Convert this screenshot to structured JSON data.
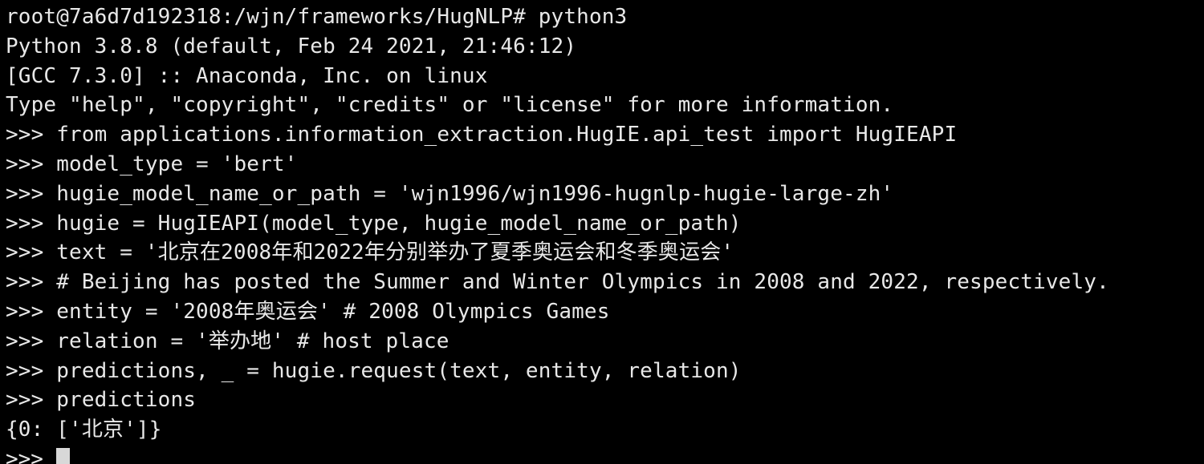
{
  "terminal": {
    "lines": [
      "root@7a6d7d192318:/wjn/frameworks/HugNLP# python3",
      "Python 3.8.8 (default, Feb 24 2021, 21:46:12)",
      "[GCC 7.3.0] :: Anaconda, Inc. on linux",
      "Type \"help\", \"copyright\", \"credits\" or \"license\" for more information.",
      ">>> from applications.information_extraction.HugIE.api_test import HugIEAPI",
      ">>> model_type = 'bert'",
      ">>> hugie_model_name_or_path = 'wjn1996/wjn1996-hugnlp-hugie-large-zh'",
      ">>> hugie = HugIEAPI(model_type, hugie_model_name_or_path)",
      ">>> text = '北京在2008年和2022年分别举办了夏季奥运会和冬季奥运会'",
      ">>> # Beijing has posted the Summer and Winter Olympics in 2008 and 2022, respectively.",
      ">>> entity = '2008年奥运会' # 2008 Olympics Games",
      ">>> relation = '举办地' # host place",
      ">>> predictions, _ = hugie.request(text, entity, relation)",
      ">>> predictions",
      "{0: ['北京']}"
    ],
    "prompt": ">>> ",
    "colors": {
      "background": "#000000",
      "foreground": "#e8e8e8",
      "cursor": "#d8d8d8"
    }
  }
}
